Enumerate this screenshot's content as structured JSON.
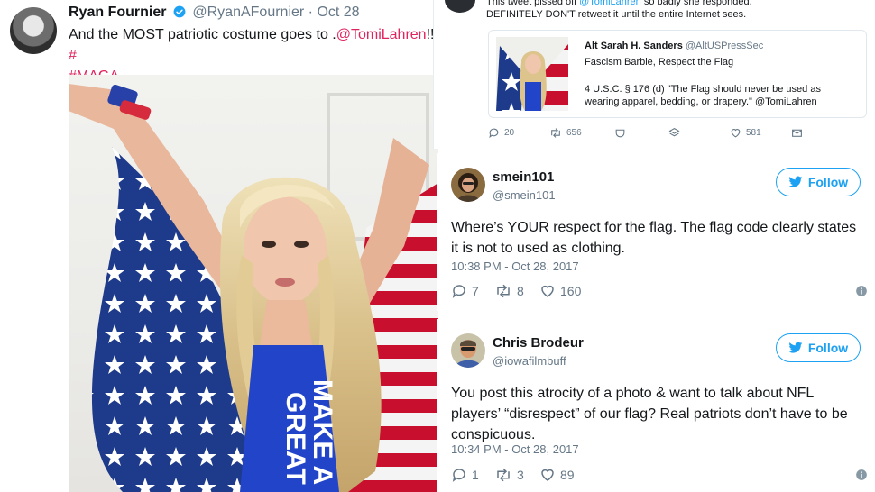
{
  "left_tweet": {
    "name": "Ryan Fournier",
    "handle": "@RyanAFournier",
    "date": "· Oct 28",
    "text_before": "And the MOST patriotic costume goes to .",
    "mention": "@TomiLahren",
    "text_after": "!! ",
    "hashtag_cut": "#",
    "hashtag": "#MAGA",
    "shirt_text_line1": "MAKE A",
    "shirt_text_line2": "GREAT"
  },
  "top_right": {
    "line1_prefix": "This tweet pissed off ",
    "line1_mention": "@TomiLahren",
    "line1_suffix": " so badly she responded.",
    "line2": "DEFINITELY DON'T retweet it until the entire Internet sees.",
    "quote": {
      "name": "Alt Sarah H. Sanders",
      "handle": "@AltUSPressSec",
      "line1": "Fascism Barbie, Respect the Flag",
      "line2": "4 U.S.C. § 176 (d) \"The Flag should never be used as",
      "line3": "wearing apparel, bedding, or drapery.\" @TomiLahren"
    },
    "actions": {
      "replies": "20",
      "retweets": "656",
      "likes": "581"
    }
  },
  "tweets": [
    {
      "name": "smein101",
      "handle": "@smein101",
      "follow_label": "Follow",
      "body": "Where’s YOUR respect for the flag. The flag code clearly states it is not to used as clothing.",
      "time": "10:38 PM - Oct 28, 2017",
      "replies": "7",
      "retweets": "8",
      "likes": "160"
    },
    {
      "name": "Chris Brodeur",
      "handle": "@iowafilmbuff",
      "follow_label": "Follow",
      "body": "You post this atrocity of a photo & want to talk about NFL players’ “disrespect” of our flag? Real patriots don’t have to be conspicuous.",
      "time": "10:34 PM - Oct 28, 2017",
      "replies": "1",
      "retweets": "3",
      "likes": "89"
    }
  ],
  "colors": {
    "twitter_blue": "#1da1f2",
    "link_pink": "#e0245e",
    "muted_gray": "#657786",
    "flag_red": "#c8102e",
    "flag_blue": "#1e3a8a"
  }
}
